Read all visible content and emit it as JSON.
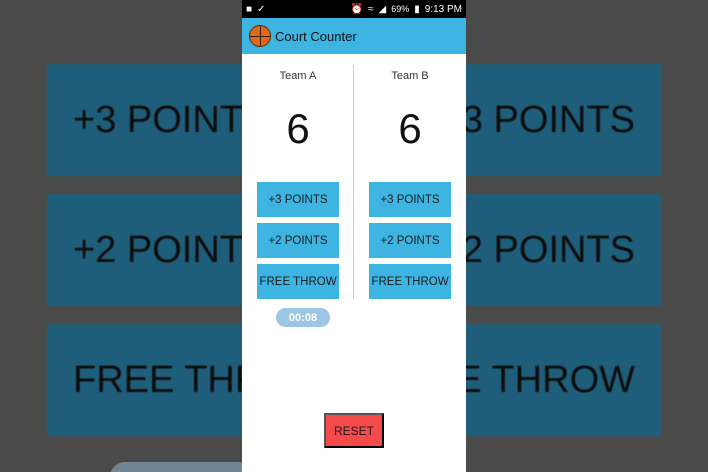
{
  "background": {
    "left_labels": [
      "+3 POINTS",
      "+2 POINTS",
      "FREE THROW"
    ],
    "right_labels": [
      "+3 POINTS",
      "+2 POINTS",
      "FREE THROW"
    ]
  },
  "status_bar": {
    "battery": "69%",
    "time": "9:13 PM"
  },
  "app_bar": {
    "title": "Court Counter"
  },
  "team_a": {
    "name": "Team A",
    "score": "6",
    "buttons": [
      "+3 POINTS",
      "+2 POINTS",
      "FREE THROW"
    ]
  },
  "team_b": {
    "name": "Team B",
    "score": "6",
    "buttons": [
      "+3 POINTS",
      "+2 POINTS",
      "FREE THROW"
    ]
  },
  "timer": "00:08",
  "reset_label": "RESET",
  "colors": {
    "accent": "#3db4e2",
    "reset": "#f44a4a"
  }
}
